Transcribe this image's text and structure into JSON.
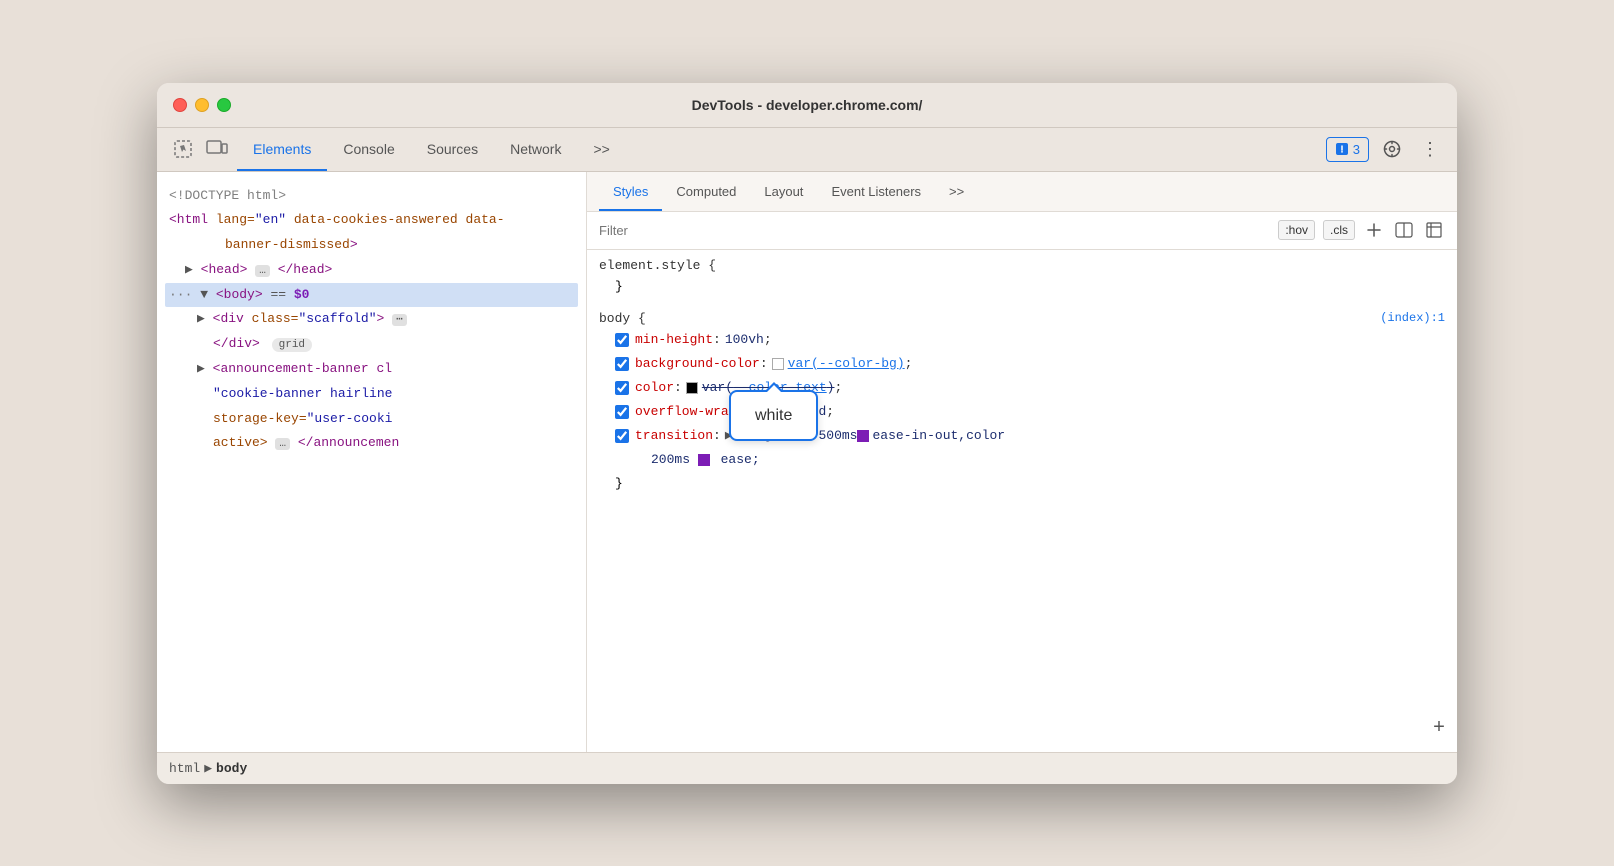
{
  "window": {
    "title": "DevTools - developer.chrome.com/"
  },
  "traffic_lights": {
    "red": "close",
    "yellow": "minimize",
    "green": "maximize"
  },
  "tabs": {
    "items": [
      {
        "label": "Elements",
        "active": true
      },
      {
        "label": "Console",
        "active": false
      },
      {
        "label": "Sources",
        "active": false
      },
      {
        "label": "Network",
        "active": false
      },
      {
        "label": ">>",
        "active": false
      }
    ]
  },
  "right_icons": {
    "badge": "3",
    "settings": "⚙",
    "more": "⋮"
  },
  "dom": {
    "lines": [
      {
        "text": "<!DOCTYPE html>",
        "class": "comment",
        "indent": 0
      },
      {
        "text": "<html lang=\"en\" data-cookies-answered data-banner-dismissed>",
        "indent": 0
      },
      {
        "text": "▶ <head> … </head>",
        "indent": 1
      },
      {
        "text": "▼ <body> == $0",
        "indent": 0,
        "selected": true
      },
      {
        "text": "▶ <div class=\"scaffold\"> ⋯",
        "indent": 2
      },
      {
        "text": "</div>",
        "indent": 3,
        "badge": "grid"
      },
      {
        "text": "▶ <announcement-banner cl",
        "indent": 2
      },
      {
        "text": "\"cookie-banner hairline",
        "indent": 3
      },
      {
        "text": "storage-key=\"user-cooki",
        "indent": 3
      },
      {
        "text": "active> … </announcemen",
        "indent": 3
      }
    ]
  },
  "breadcrumb": {
    "items": [
      "html",
      "body"
    ]
  },
  "styles_tabs": {
    "items": [
      {
        "label": "Styles",
        "active": true
      },
      {
        "label": "Computed",
        "active": false
      },
      {
        "label": "Layout",
        "active": false
      },
      {
        "label": "Event Listeners",
        "active": false
      },
      {
        "label": ">>",
        "active": false
      }
    ]
  },
  "filter": {
    "placeholder": "Filter",
    "hov_label": ":hov",
    "cls_label": ".cls"
  },
  "rules": {
    "element_style": {
      "selector": "element.style {",
      "close": "}"
    },
    "body_rule": {
      "selector": "body {",
      "source": "(index):1",
      "close": "}",
      "properties": [
        {
          "name": "min-height",
          "value": "100vh",
          "checked": true,
          "swatch": null,
          "link": false
        },
        {
          "name": "background-color",
          "value": "var(--color-bg)",
          "checked": true,
          "swatch": "white",
          "link": true
        },
        {
          "name": "color",
          "value": "var(--color-text);",
          "checked": true,
          "swatch": "black",
          "link": true,
          "strikethrough": false
        },
        {
          "name": "overflow-wrap",
          "value": "break-word;",
          "checked": true,
          "swatch": null,
          "link": false
        },
        {
          "name": "transition",
          "value": "background 500ms ease-in-out,color 200ms ease;",
          "checked": true,
          "swatch": null,
          "link": false,
          "expanded": false
        }
      ]
    }
  },
  "tooltip": {
    "text": "white"
  }
}
